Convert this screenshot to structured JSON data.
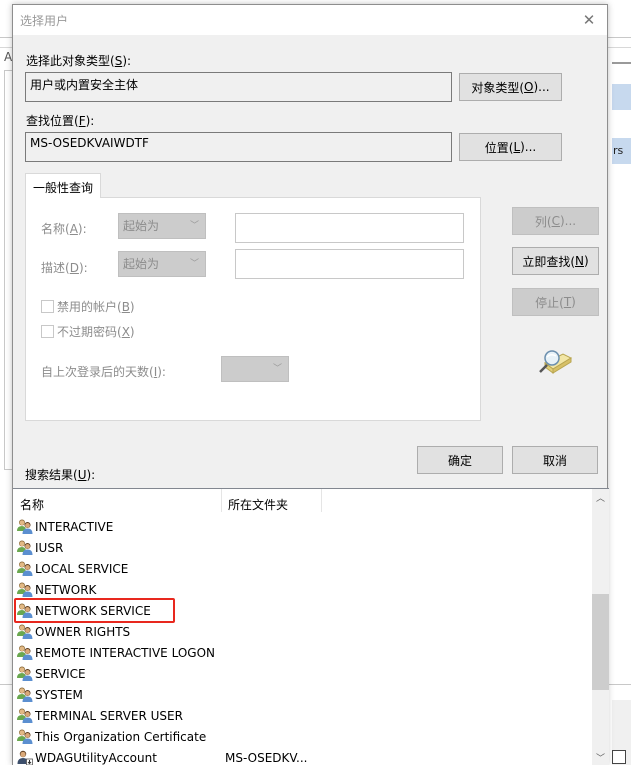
{
  "background": {
    "partial_letter": "A",
    "partial_text": "rs"
  },
  "dialog": {
    "title": "选择用户",
    "close_glyph": "✕",
    "object_type": {
      "label": "选择此对象类型(",
      "label_key": "S",
      "label_end": "):",
      "value": "用户或内置安全主体",
      "button_label": "对象类型(",
      "button_key": "O",
      "button_end": ")..."
    },
    "location": {
      "label": "查找位置(",
      "label_key": "F",
      "label_end": "):",
      "value": "MS-OSEDKVAIWDTF",
      "button_label": "位置(",
      "button_key": "L",
      "button_end": ")..."
    },
    "query_tab": {
      "label": "一般性查询",
      "name_label": "名称(",
      "name_key": "A",
      "name_end": "):",
      "name_mode": "起始为",
      "name_value": "",
      "desc_label": "描述(",
      "desc_key": "D",
      "desc_end": "):",
      "desc_mode": "起始为",
      "desc_value": "",
      "disabled_accounts": {
        "label": "禁用的帐户(",
        "key": "B",
        "end": ")",
        "checked": false
      },
      "non_expiring": {
        "label": "不过期密码(",
        "key": "X",
        "end": ")",
        "checked": false
      },
      "days_label": "自上次登录后的天数(",
      "days_key": "I",
      "days_end": "):",
      "days_value": ""
    },
    "side_buttons": {
      "columns": {
        "label": "列(",
        "key": "C",
        "end": ")...",
        "enabled": false
      },
      "find_now": {
        "label": "立即查找(",
        "key": "N",
        "end": ")",
        "enabled": true
      },
      "stop": {
        "label": "停止(",
        "key": "T",
        "end": ")",
        "enabled": false
      }
    },
    "search_icon": "search-directory-icon",
    "ok_label": "确定",
    "cancel_label": "取消",
    "results_label": "搜索结果(",
    "results_key": "U",
    "results_end": "):",
    "results": {
      "columns": [
        "名称",
        "所在文件夹"
      ],
      "highlighted_index": 4,
      "scroll_fraction": 0.6,
      "rows": [
        {
          "name": "INTERACTIVE",
          "folder": "",
          "icon": "group-icon"
        },
        {
          "name": "IUSR",
          "folder": "",
          "icon": "group-icon"
        },
        {
          "name": "LOCAL SERVICE",
          "folder": "",
          "icon": "group-icon"
        },
        {
          "name": "NETWORK",
          "folder": "",
          "icon": "group-icon"
        },
        {
          "name": "NETWORK SERVICE",
          "folder": "",
          "icon": "group-icon"
        },
        {
          "name": "OWNER RIGHTS",
          "folder": "",
          "icon": "group-icon"
        },
        {
          "name": "REMOTE INTERACTIVE LOGON",
          "folder": "",
          "icon": "group-icon"
        },
        {
          "name": "SERVICE",
          "folder": "",
          "icon": "group-icon"
        },
        {
          "name": "SYSTEM",
          "folder": "",
          "icon": "group-icon"
        },
        {
          "name": "TERMINAL SERVER USER",
          "folder": "",
          "icon": "group-icon"
        },
        {
          "name": "This Organization Certificate",
          "folder": "",
          "icon": "group-icon"
        },
        {
          "name": "WDAGUtilityAccount",
          "folder": "MS-OSEDKV...",
          "icon": "user-icon"
        }
      ]
    },
    "highlight_color": "#e8281e"
  }
}
